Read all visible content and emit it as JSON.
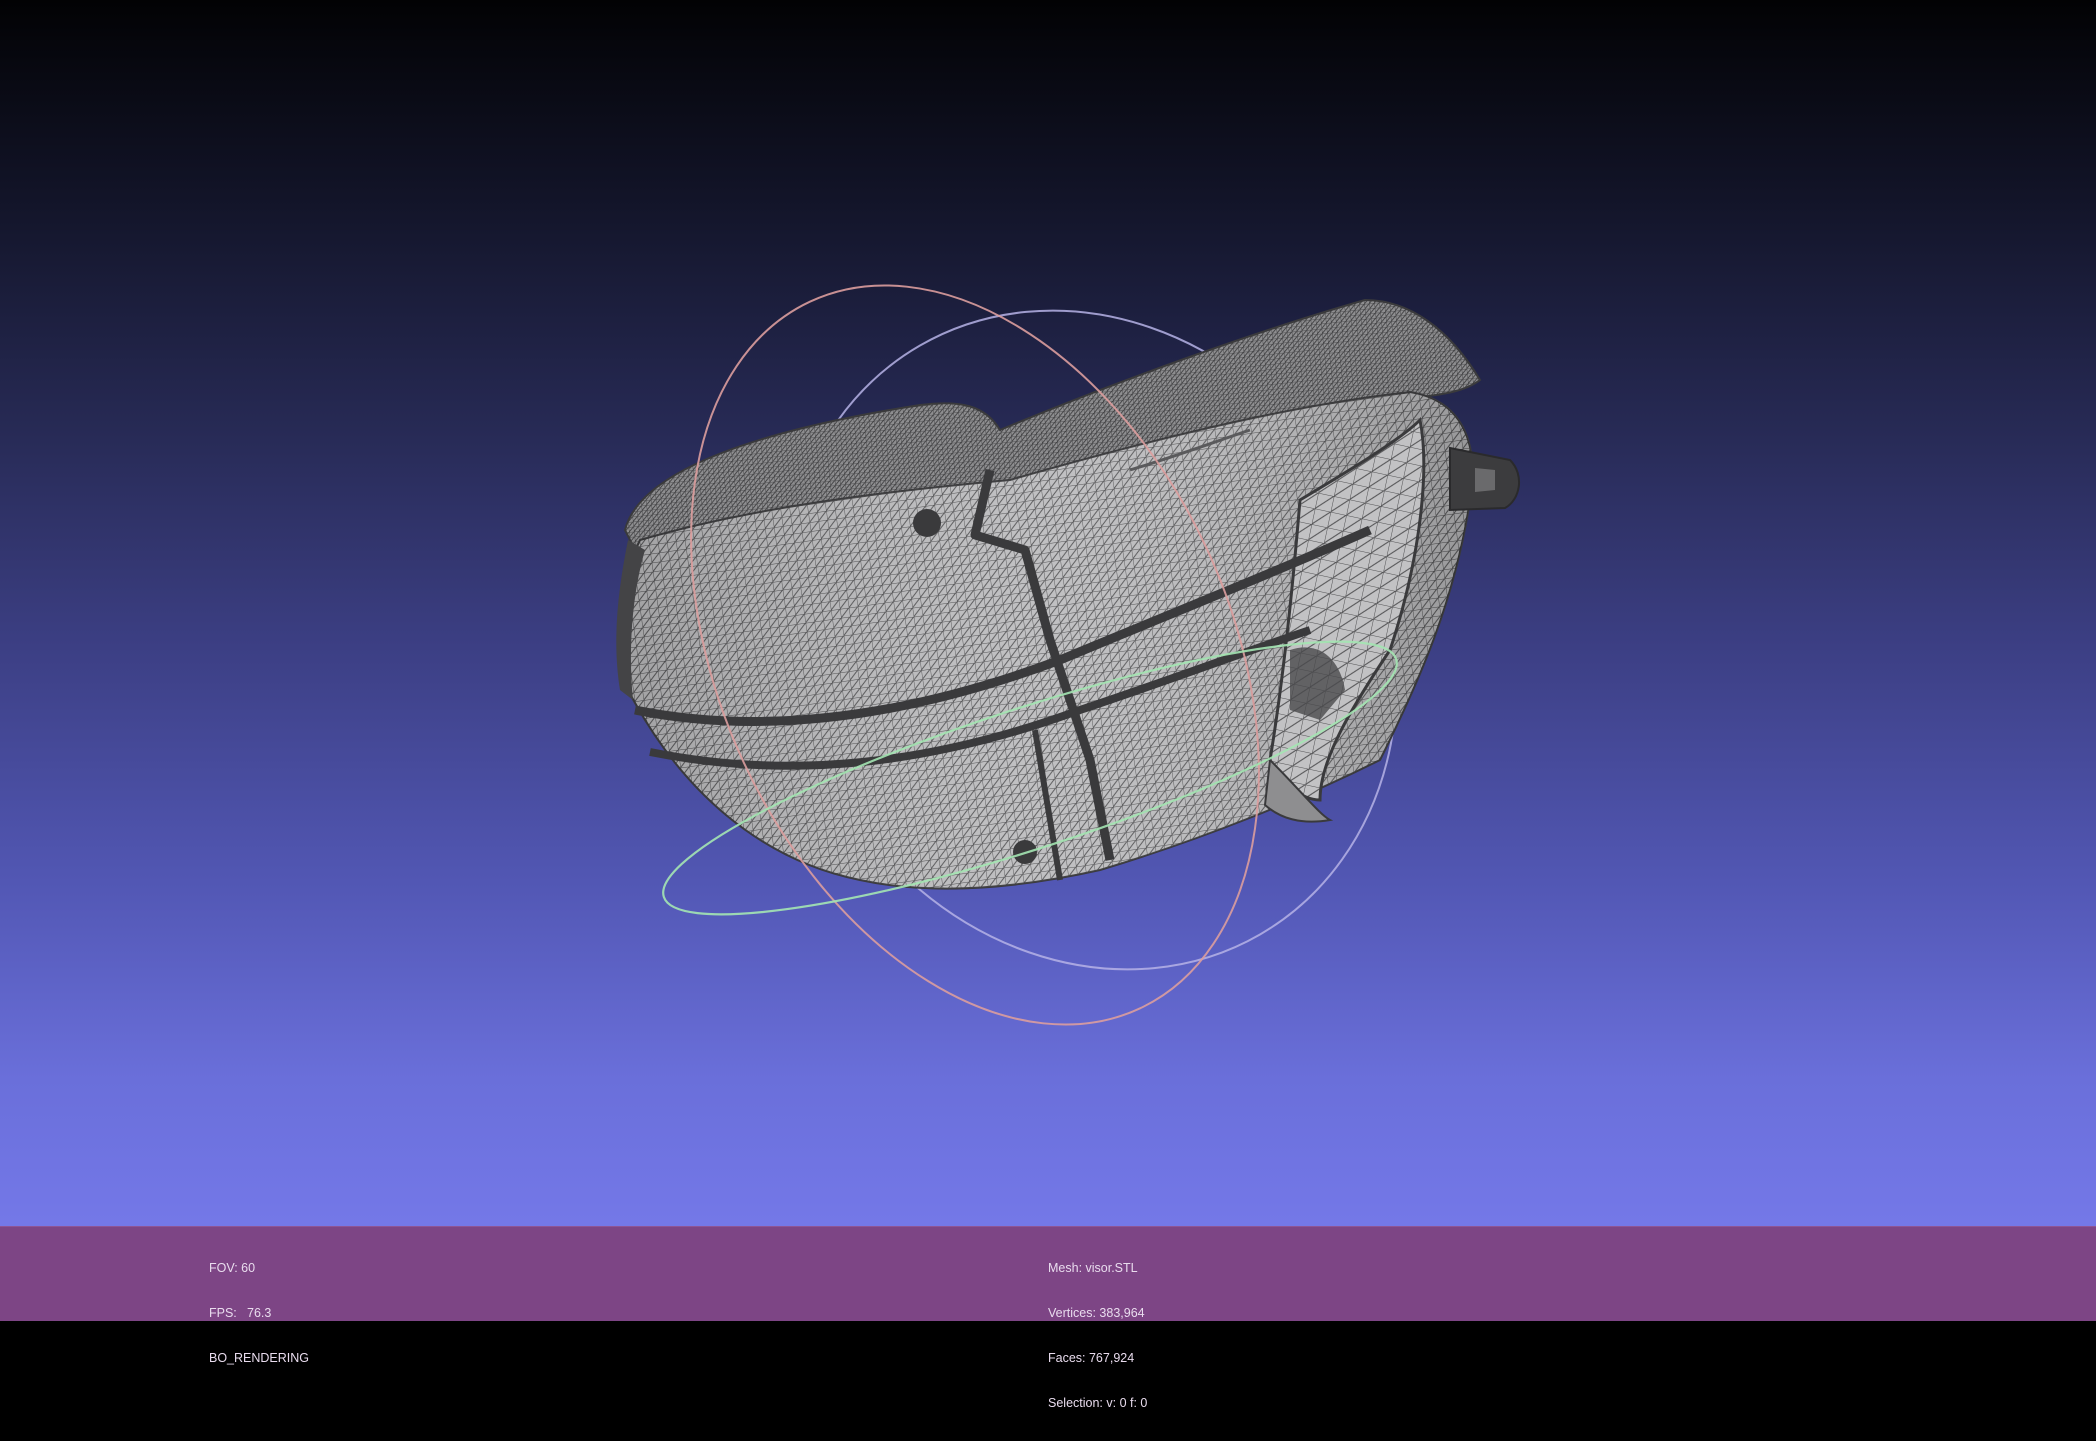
{
  "viewer": {
    "background_top": "#020204",
    "background_bottom": "#7478e8",
    "mesh_color": "#b9b9bb",
    "wire_color": "#3c3c3e",
    "trackball_colors": {
      "x_ring": "#d98c8c",
      "y_ring": "#9be3a8",
      "z_ring": "#a8a4e8"
    }
  },
  "info_left": {
    "fov": "FOV: 60",
    "fps_label": "FPS:",
    "fps_value": "76.3",
    "render_mode": "BO_RENDERING"
  },
  "info_right": {
    "mesh": "Mesh: visor.STL",
    "vertices": "Vertices: 383,964",
    "faces": "Faces: 767,924",
    "selection": "Selection: v: 0 f: 0"
  },
  "info_bar_color": "#7d4585"
}
